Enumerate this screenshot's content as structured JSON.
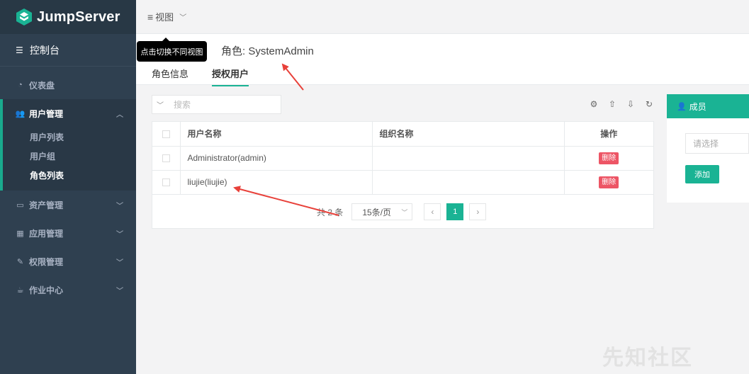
{
  "brand": {
    "name": "JumpServer",
    "accent": "#1ab394",
    "sidebar_bg": "#2f4050",
    "danger": "#ed5565"
  },
  "sidebar": {
    "console_label": "控制台",
    "items": [
      {
        "label": "仪表盘",
        "icon": "dashboard-icon"
      },
      {
        "label": "用户管理",
        "icon": "users-icon",
        "children": [
          {
            "label": "用户列表"
          },
          {
            "label": "用户组"
          },
          {
            "label": "角色列表"
          }
        ]
      },
      {
        "label": "资产管理",
        "icon": "inbox-icon"
      },
      {
        "label": "应用管理",
        "icon": "grid-icon"
      },
      {
        "label": "权限管理",
        "icon": "edit-icon"
      },
      {
        "label": "作业中心",
        "icon": "coffee-icon"
      }
    ]
  },
  "topbar": {
    "view_label": "视图"
  },
  "tooltip": "点击切换不同视图",
  "page": {
    "title": "角色: SystemAdmin",
    "tabs": [
      {
        "label": "角色信息"
      },
      {
        "label": "授权用户"
      }
    ]
  },
  "table": {
    "search_placeholder": "搜索",
    "tool_icons": [
      "gear-icon",
      "upload-icon",
      "download-icon",
      "refresh-icon"
    ],
    "columns": [
      "用户名称",
      "组织名称",
      "操作"
    ],
    "rows": [
      {
        "user": "Administrator(admin)",
        "org": "",
        "action": "删除"
      },
      {
        "user": "liujie(liujie)",
        "org": "",
        "action": "删除"
      }
    ],
    "total": "共 2 条",
    "page_size": "15条/页",
    "current_page": "1"
  },
  "member": {
    "title": "成员",
    "select_placeholder": "请选择",
    "add_label": "添加"
  },
  "watermark": "先知社区"
}
